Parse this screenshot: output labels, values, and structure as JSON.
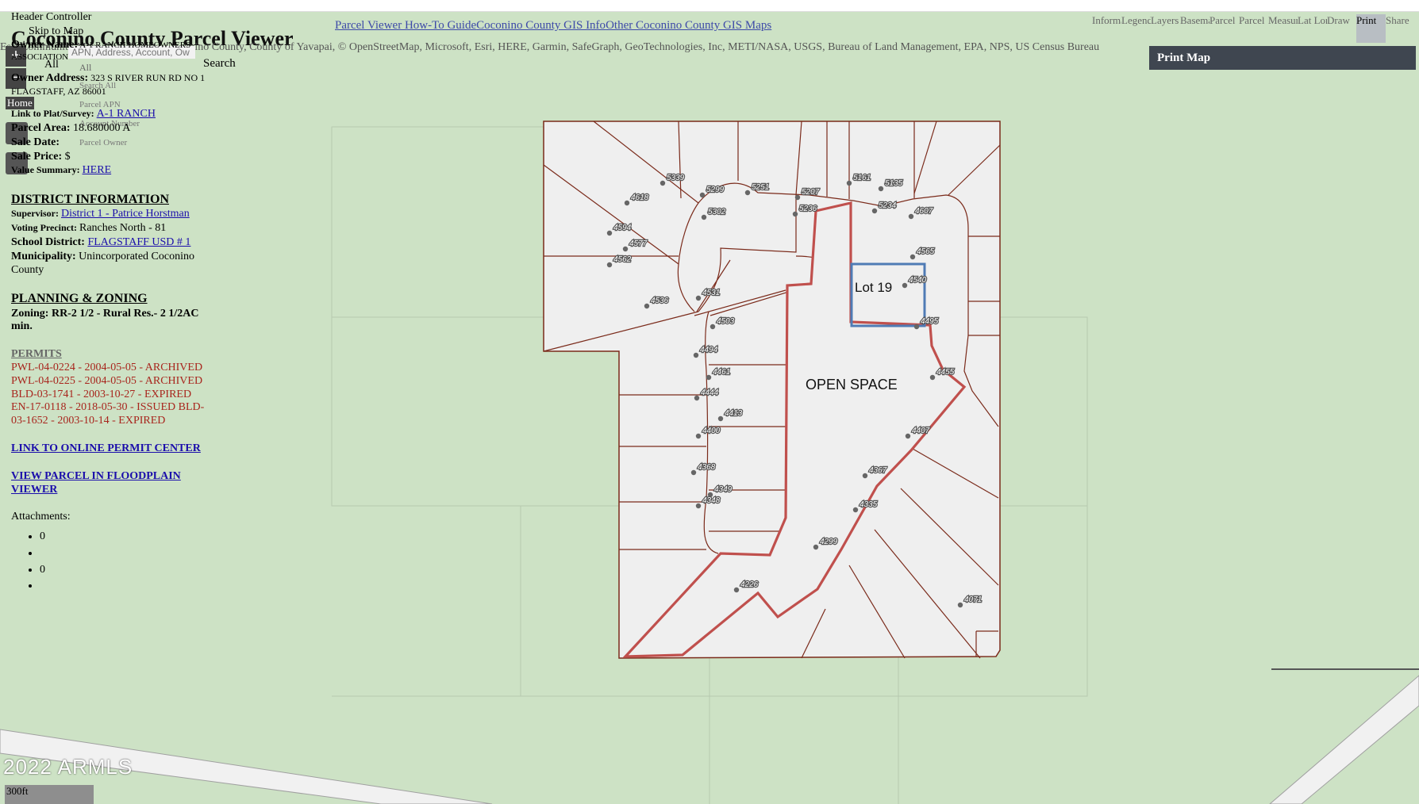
{
  "header": {
    "skip_links": [
      "Header Controller",
      "Skip to Map"
    ],
    "app_title": "Coconino County Parcel Viewer",
    "links": [
      "Parcel Viewer How-To Guide",
      "Coconino County GIS Info",
      "Other Coconino County GIS Maps"
    ],
    "attribution": "Esri Community Maps Contributors, Coconino County, County of Yavapai, © OpenStreetMap, Microsoft, Esri, HERE, Garmin, SafeGraph, GeoTechnologies, Inc, METI/NASA, USGS, Bureau of Land Management, EPA, NPS, US Census Bureau"
  },
  "search": {
    "scope": "All",
    "placeholder": "APN, Address, Account, Ow",
    "button": "Search",
    "suggestions": [
      "Search All",
      "Parcel APN",
      "Account Number",
      "Parcel Owner"
    ]
  },
  "map_controls": {
    "zoom_in": "+",
    "zoom_out": "−",
    "home": "Home"
  },
  "parcel": {
    "owner_label": "Owner Name:",
    "owner_value": "A-1 RANCH HOMEOWNERS ASSOCIATION",
    "address_label": "Owner Address:",
    "address_value": "323 S RIVER RUN RD NO 1 FLAGSTAFF, AZ 86001",
    "plat_label": "Link to Plat/Survey:",
    "plat_value": "A-1 RANCH",
    "area_label": "Parcel Area:",
    "area_value": "18.680000 A",
    "sale_date_label": "Sale Date:",
    "sale_date_value": "",
    "sale_price_label": "Sale Price:",
    "sale_price_value": "$",
    "value_label": "Value Summary:",
    "value_value": "HERE"
  },
  "district": {
    "heading": "DISTRICT INFORMATION",
    "supervisor_label": "Supervisor:",
    "supervisor_value": "District 1 - Patrice Horstman",
    "precinct_label": "Voting Precinct:",
    "precinct_value": "Ranches North - 81",
    "school_label": "School District:",
    "school_value": "FLAGSTAFF USD # 1",
    "muni_label": "Municipality:",
    "muni_value": "Unincorporated Coconino County"
  },
  "planning": {
    "heading": "PLANNING & ZONING",
    "zoning": "Zoning: RR-2 1/2 - Rural Res.- 2 1/2AC min.",
    "permits_label": "PERMITS",
    "permits_text": "PWL-04-0224 - 2004-05-05 - ARCHIVED PWL-04-0225 - 2004-05-05 - ARCHIVED BLD-03-1741 - 2003-10-27 - EXPIRED EN-17-0118 - 2018-05-30 - ISSUED BLD-03-1652 - 2003-10-14 - EXPIRED",
    "permit_center_link": "LINK TO ONLINE PERMIT CENTER",
    "floodplain_link": "VIEW PARCEL IN FLOODPLAIN VIEWER",
    "attachments_label": "Attachments:",
    "attachments": [
      "0",
      "",
      "0",
      ""
    ]
  },
  "toolbar": {
    "tools": [
      "Information",
      "Legend",
      "Layers",
      "Basemap",
      "Parcel",
      "Parcel",
      "Measure",
      "Lat Long",
      "Draw",
      "Print",
      "Share"
    ],
    "active": "Print",
    "print_panel_title": "Print Map"
  },
  "plat": {
    "lot_label": "Lot 19",
    "open_space_label": "OPEN SPACE",
    "parcels": [
      "4618",
      "5339",
      "5299",
      "5251",
      "5207",
      "5161",
      "5135",
      "5234",
      "5236",
      "5302",
      "4594",
      "4577",
      "4562",
      "4607",
      "4565",
      "4540",
      "4536",
      "4531",
      "4503",
      "4495",
      "4494",
      "4461",
      "4455",
      "4444",
      "4413",
      "4400",
      "4407",
      "4368",
      "4367",
      "4349",
      "4348",
      "4335",
      "4299",
      "4226",
      "4071"
    ]
  },
  "footer": {
    "copyright": "2022 ARMLS",
    "scale": "300ft"
  },
  "colors": {
    "map_background": "#cde2c5",
    "parcel_fill": "#efefef",
    "parcel_line": "#7a2a1a",
    "open_space_outline": "#c0504d",
    "lot_outline": "#4f7bb5",
    "permit_text": "#a8251d",
    "print_panel": "#3f4650"
  }
}
